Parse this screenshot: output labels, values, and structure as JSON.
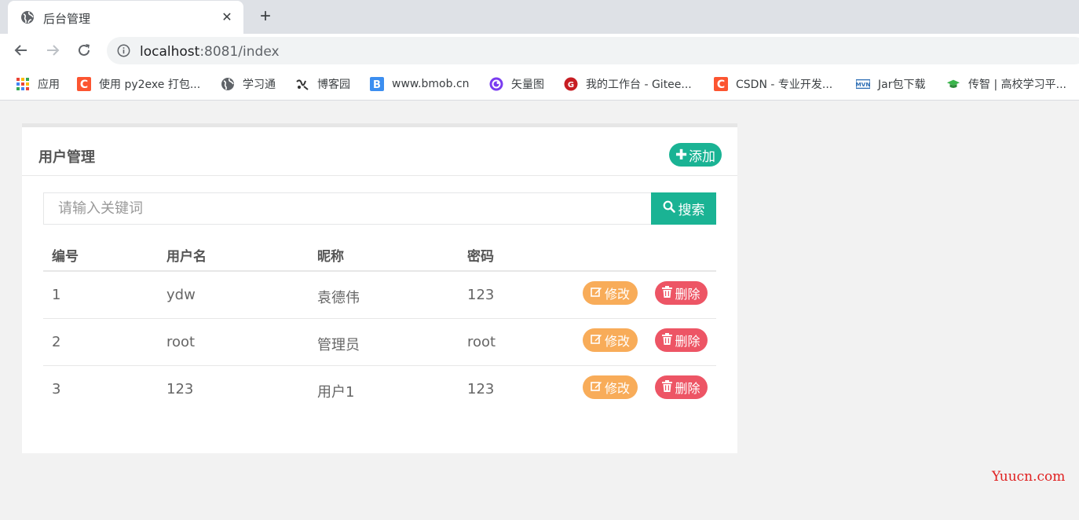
{
  "browser": {
    "tab_title": "后台管理",
    "close_glyph": "✕",
    "newtab_glyph": "+",
    "url_host": "localhost",
    "url_rest": ":8081/index"
  },
  "bookmarks": [
    {
      "label": "应用",
      "icon": "apps-grid-icon"
    },
    {
      "label": "使用 py2exe 打包...",
      "icon": "csdn-icon"
    },
    {
      "label": "学习通",
      "icon": "globe-icon"
    },
    {
      "label": "博客园",
      "icon": "cnblogs-icon"
    },
    {
      "label": "www.bmob.cn",
      "icon": "bmob-icon"
    },
    {
      "label": "矢量图",
      "icon": "iconfont-icon"
    },
    {
      "label": "我的工作台 - Gitee...",
      "icon": "gitee-icon"
    },
    {
      "label": "CSDN - 专业开发...",
      "icon": "csdn-icon"
    },
    {
      "label": "Jar包下载",
      "icon": "mvn-icon"
    },
    {
      "label": "传智 | 高校学习平...",
      "icon": "graduation-cap-icon"
    }
  ],
  "panel": {
    "title": "用户管理",
    "add_label": "添加"
  },
  "search": {
    "placeholder": "请输入关键词",
    "value": "",
    "button_label": "搜索"
  },
  "table": {
    "headers": [
      "编号",
      "用户名",
      "昵称",
      "密码"
    ],
    "rows": [
      {
        "id": "1",
        "username": "ydw",
        "nickname": "袁德伟",
        "password": "123"
      },
      {
        "id": "2",
        "username": "root",
        "nickname": "管理员",
        "password": "root"
      },
      {
        "id": "3",
        "username": "123",
        "nickname": "用户1",
        "password": "123"
      }
    ],
    "edit_label": "修改",
    "delete_label": "删除"
  },
  "watermark": "Yuucn.com",
  "colors": {
    "primary": "#1ab394",
    "warning": "#f8ac59",
    "danger": "#ed5565",
    "watermark": "#e02020"
  }
}
